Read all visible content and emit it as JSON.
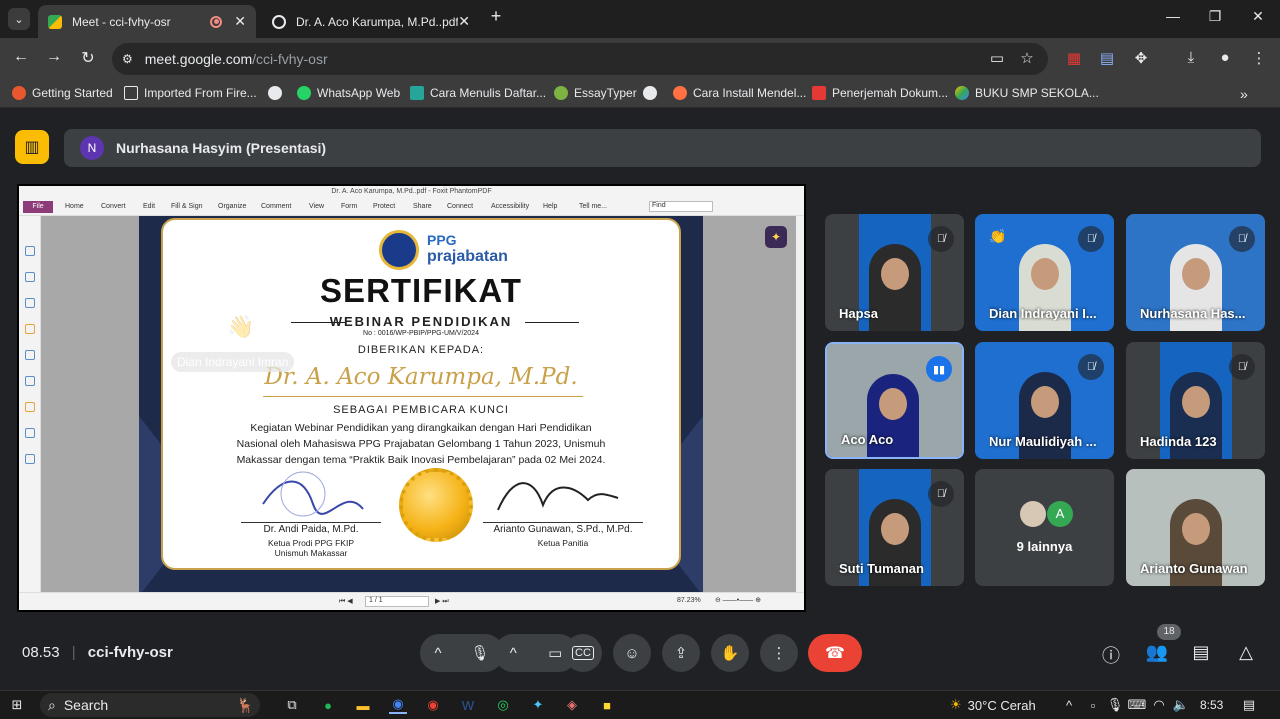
{
  "browser": {
    "tabs": [
      {
        "title": "Meet - cci-fvhy-osr",
        "active": true
      },
      {
        "title": "Dr. A. Aco Karumpa, M.Pd..pdf",
        "active": false
      }
    ],
    "new_tab": "+",
    "url_host": "meet.google.com",
    "url_path": "/cci-fvhy-osr",
    "bookmarks": [
      "Getting Started",
      "Imported From Fire...",
      "WhatsApp Web",
      "Cara Menulis Daftar...",
      "EssayTyper",
      "Cara Install Mendel...",
      "Penerjemah Dokum...",
      "BUKU SMP SEKOLA..."
    ]
  },
  "meet": {
    "presenter_initial": "N",
    "presenter_label": "Nurhasana Hasyim (Presentasi)",
    "floating_name": "Dian Indrayani Imran",
    "participants": [
      {
        "name": "Hapsa",
        "muted": true
      },
      {
        "name": "Dian Indrayani I...",
        "muted": true,
        "reaction": "👏"
      },
      {
        "name": "Nurhasana Has...",
        "muted": true
      },
      {
        "name": "Aco Aco",
        "muted": false,
        "speaking": true
      },
      {
        "name": "Nur Maulidiyah ...",
        "muted": true
      },
      {
        "name": "Hadinda 123",
        "muted": true
      },
      {
        "name": "Suti Tumanan",
        "muted": true
      },
      {
        "name": "9 lainnya",
        "others_initial": "A"
      },
      {
        "name": "Arianto Gunawan",
        "muted": false
      }
    ],
    "time": "08.53",
    "meeting_code": "cci-fvhy-osr",
    "people_count": "18"
  },
  "pdf": {
    "window_title": "Dr. A. Aco Karumpa, M.Pd..pdf - Foxit PhantomPDF",
    "menu": [
      "File",
      "Home",
      "Convert",
      "Edit",
      "Fill & Sign",
      "Organize",
      "Comment",
      "View",
      "Form",
      "Protect",
      "Share",
      "Connect",
      "Accessibility",
      "Help"
    ],
    "tell_me": "Tell me...",
    "find_placeholder": "Find",
    "page_indicator": "1 / 1",
    "zoom": "87.23%"
  },
  "certificate": {
    "ppg_line1": "PPG",
    "ppg_line2": "prajabatan",
    "title": "SERTIFIKAT",
    "subtitle": "WEBINAR PENDIDIKAN",
    "number": "No : 0016/WP-PBIP/PPG-UM/V/2024",
    "given_to": "DIBERIKAN KEPADA:",
    "recipient": "Dr. A. Aco Karumpa, M.Pd.",
    "role": "SEBAGAI PEMBICARA KUNCI",
    "body_line1": "Kegiatan Webinar Pendidikan yang dirangkaikan dengan Hari Pendidikan",
    "body_line2": "Nasional oleh Mahasiswa PPG Prajabatan Gelombang 1 Tahun 2023, Unismuh",
    "body_line3": "Makassar dengan tema “Praktik Baik Inovasi Pembelajaran” pada 02 Mei 2024.",
    "signer1_name": "Dr. Andi Paida, M.Pd.",
    "signer1_title1": "Ketua Prodi PPG FKIP",
    "signer1_title2": "Unismuh Makassar",
    "signer2_name": "Arianto Gunawan, S.Pd., M.Pd.",
    "signer2_title": "Ketua Panitia"
  },
  "taskbar": {
    "search": "Search",
    "weather": "30°C  Cerah",
    "clock": "8:53"
  }
}
